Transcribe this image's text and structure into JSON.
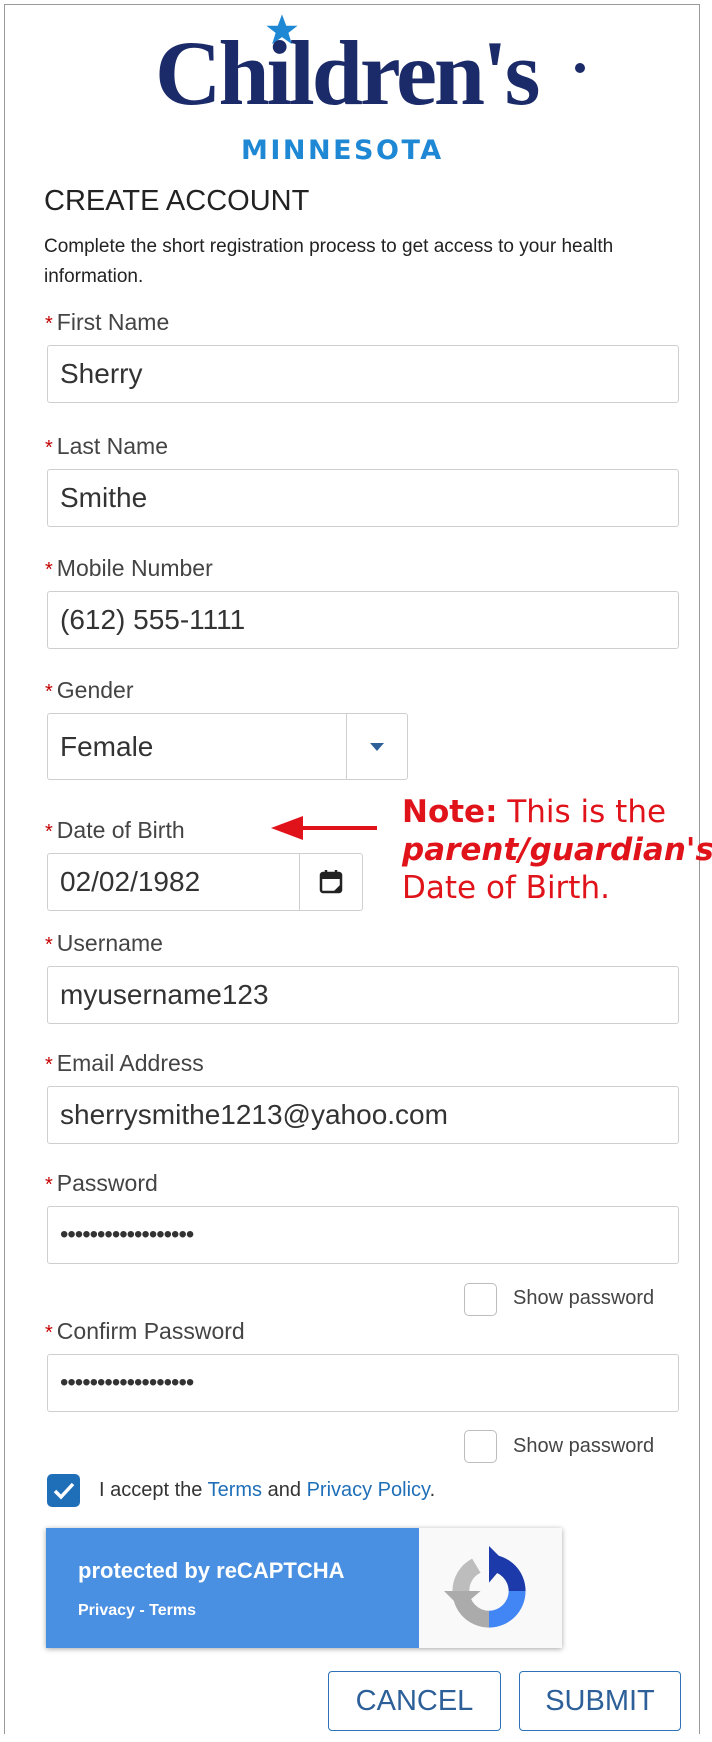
{
  "logo": {
    "wordmark": "Children's",
    "subtitle": "MINNESOTA",
    "brand_color": "#1b2a68",
    "accent_color": "#1e88d4"
  },
  "page_title": "CREATE ACCOUNT",
  "intro": "Complete the short registration process to get access to your health information.",
  "required_marker": "*",
  "fields": {
    "first_name": {
      "label": "First Name",
      "value": "Sherry"
    },
    "last_name": {
      "label": "Last Name",
      "value": "Smithe"
    },
    "mobile": {
      "label": "Mobile Number",
      "value": "(612) 555-1111"
    },
    "gender": {
      "label": "Gender",
      "value": "Female"
    },
    "dob": {
      "label": "Date of Birth",
      "value": "02/02/1982"
    },
    "username": {
      "label": "Username",
      "value": "myusername123"
    },
    "email": {
      "label": "Email Address",
      "value": "sherrysmithe1213@yahoo.com"
    },
    "password": {
      "label": "Password",
      "value": "••••••••••••••••••"
    },
    "confirm_password": {
      "label": "Confirm Password",
      "value": "••••••••••••••••••"
    }
  },
  "show_password_label": "Show password",
  "note": {
    "bold": "Note:",
    "text1": "This is the",
    "emphasis": "parent/guardian's",
    "text2": "Date of Birth.",
    "color": "#e0131a"
  },
  "accept": {
    "prefix": "I accept the",
    "terms": "Terms",
    "and": "and",
    "privacy": "Privacy Policy",
    "suffix": ".",
    "checked": true
  },
  "recaptcha": {
    "title": "protected by reCAPTCHA",
    "privacy": "Privacy",
    "separator": "-",
    "terms": "Terms"
  },
  "buttons": {
    "cancel": "CANCEL",
    "submit": "SUBMIT"
  }
}
